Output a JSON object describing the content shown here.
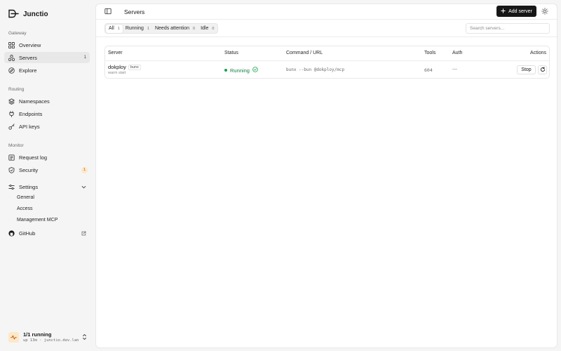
{
  "app": {
    "name": "Junctio"
  },
  "sidebar": {
    "sections": {
      "gateway": "Gateway",
      "routing": "Routing",
      "monitor": "Monitor"
    },
    "items": {
      "overview": "Overview",
      "servers": {
        "label": "Servers",
        "count": "1"
      },
      "explore": "Explore",
      "namespaces": "Namespaces",
      "endpoints": "Endpoints",
      "api_keys": "API keys",
      "request_log": "Request log",
      "security": {
        "label": "Security",
        "badge": "1"
      },
      "settings": "Settings",
      "github": "GitHub"
    },
    "settings_sub": {
      "general": "General",
      "access": "Access",
      "management_mcp": "Management MCP"
    },
    "status": {
      "title": "1/1 running",
      "subtitle": "up 13m · junctio.dev.lan"
    }
  },
  "header": {
    "title": "Servers",
    "add_button": "Add server"
  },
  "filters": {
    "tabs": [
      {
        "label": "All",
        "count": "1"
      },
      {
        "label": "Running",
        "count": "1"
      },
      {
        "label": "Needs attention",
        "count": "0"
      },
      {
        "label": "Idle",
        "count": "0"
      }
    ],
    "search_placeholder": "Search servers..."
  },
  "table": {
    "columns": {
      "server": "Server",
      "status": "Status",
      "command": "Command / URL",
      "tools": "Tools",
      "auth": "Auth",
      "actions": "Actions"
    },
    "rows": [
      {
        "name": "dokploy",
        "tag": "bunx",
        "sub": "warm start",
        "status": "Running",
        "command": "bunx --bun @dokploy/mcp",
        "tools": "604",
        "auth": "—",
        "action": "Stop"
      }
    ]
  },
  "colors": {
    "accent": "#171717",
    "running": "#15803d",
    "warning_bg": "#fde8c8"
  }
}
